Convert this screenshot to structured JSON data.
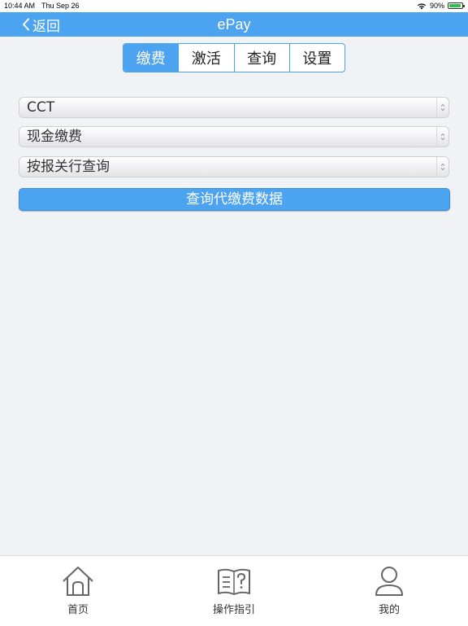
{
  "status_bar": {
    "time": "10:44 AM",
    "date": "Thu Sep 26",
    "battery": "90%",
    "battery_level": 0.9
  },
  "nav": {
    "back_label": "返回",
    "title": "ePay"
  },
  "segments": [
    {
      "label": "缴费",
      "active": true
    },
    {
      "label": "激活",
      "active": false
    },
    {
      "label": "查询",
      "active": false
    },
    {
      "label": "设置",
      "active": false
    }
  ],
  "form": {
    "selects": [
      {
        "value": "CCT"
      },
      {
        "value": "现金缴费"
      },
      {
        "value": "按报关行查询"
      }
    ],
    "submit_label": "查询代缴费数据"
  },
  "tabbar": {
    "items": [
      {
        "label": "首页",
        "icon": "home-icon"
      },
      {
        "label": "操作指引",
        "icon": "guide-book-icon"
      },
      {
        "label": "我的",
        "icon": "profile-icon"
      }
    ]
  },
  "colors": {
    "accent": "#4ca3f0",
    "background": "#f1f2f6"
  }
}
